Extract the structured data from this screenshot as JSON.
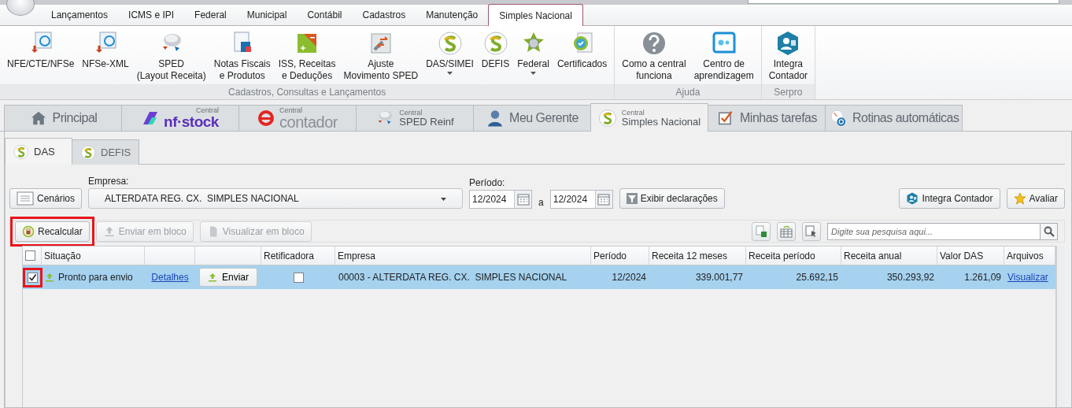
{
  "menu": {
    "tabs": [
      {
        "label": "Lançamentos",
        "selected": false
      },
      {
        "label": "ICMS e IPI",
        "selected": false
      },
      {
        "label": "Federal",
        "selected": false
      },
      {
        "label": "Municipal",
        "selected": false
      },
      {
        "label": "Contábil",
        "selected": false
      },
      {
        "label": "Cadastros",
        "selected": false
      },
      {
        "label": "Manutenção",
        "selected": false
      },
      {
        "label": "Simples Nacional",
        "selected": true
      }
    ]
  },
  "ribbon": {
    "groups": [
      {
        "label": "Cadastros, Consultas e Lançamentos",
        "buttons": [
          {
            "kind": "nfe",
            "label": "NFE/CTE/NFSe",
            "dropdown": false
          },
          {
            "kind": "nfse",
            "label": "NFSe-XML",
            "dropdown": false
          },
          {
            "kind": "sped",
            "label": "SPED\n(Layout Receita)",
            "dropdown": false
          },
          {
            "kind": "notas",
            "label": "Notas Fiscais\ne Produtos",
            "dropdown": false
          },
          {
            "kind": "iss",
            "label": "ISS, Receitas\ne Deduções",
            "dropdown": false
          },
          {
            "kind": "ajuste",
            "label": "Ajuste\nMovimento SPED",
            "dropdown": false
          },
          {
            "kind": "simples",
            "label": "DAS/SIMEI",
            "dropdown": true
          },
          {
            "kind": "simples",
            "label": "DEFIS",
            "dropdown": false
          },
          {
            "kind": "federal",
            "label": "Federal",
            "dropdown": true
          },
          {
            "kind": "cert",
            "label": "Certificados",
            "dropdown": false
          }
        ]
      },
      {
        "label": "Ajuda",
        "buttons": [
          {
            "kind": "help",
            "label": "Como a central\nfunciona",
            "dropdown": false
          },
          {
            "kind": "learn",
            "label": "Centro de\naprendizagem",
            "dropdown": false
          }
        ]
      },
      {
        "label": "Serpro",
        "buttons": [
          {
            "kind": "integra",
            "label": "Integra\nContador",
            "dropdown": false
          }
        ]
      }
    ]
  },
  "main_tabs": [
    {
      "kind": "home",
      "label": "Principal",
      "selected": false
    },
    {
      "kind": "nfstock",
      "small": "Central",
      "label": "nf·stock",
      "selected": false
    },
    {
      "kind": "contador",
      "small": "Central",
      "label": "contador",
      "selected": false
    },
    {
      "kind": "sped",
      "small": "Central",
      "label": "SPED Reinf",
      "selected": false
    },
    {
      "kind": "person",
      "label": "Meu Gerente",
      "selected": false
    },
    {
      "kind": "simples",
      "small": "Central",
      "label": "Simples Nacional",
      "selected": true
    },
    {
      "kind": "check",
      "label": "Minhas tarefas",
      "selected": false
    },
    {
      "kind": "clock",
      "label": "Rotinas automáticas",
      "selected": false
    }
  ],
  "sub_tabs": [
    {
      "label": "DAS",
      "selected": true
    },
    {
      "label": "DEFIS",
      "selected": false
    }
  ],
  "form": {
    "cenarios": "Cenários",
    "empresa_label": "Empresa:",
    "empresa_value": "ALTERDATA REG. CX.  SIMPLES NACIONAL",
    "periodo_label": "Período:",
    "periodo_from": "12/2024",
    "periodo_separator": "a",
    "periodo_to": "12/2024",
    "exibir": "Exibir declarações",
    "integra": "Integra Contador",
    "avaliar": "Avaliar"
  },
  "toolbar": {
    "buttons": [
      {
        "kind": "calc",
        "label": "Recalcular",
        "disabled": false,
        "highlighted": true
      },
      {
        "kind": "upload",
        "label": "Enviar em bloco",
        "disabled": true,
        "highlighted": false
      },
      {
        "kind": "page",
        "label": "Visualizar em bloco",
        "disabled": true,
        "highlighted": false
      }
    ],
    "search_placeholder": "Digite sua pesquisa aqui..."
  },
  "grid": {
    "columns": [
      {
        "kind": "check",
        "checked": false
      },
      {
        "kind": "text",
        "label": "Situação"
      },
      {
        "kind": "blank"
      },
      {
        "kind": "blank"
      },
      {
        "kind": "text",
        "label": "Retificadora"
      },
      {
        "kind": "text",
        "label": "Empresa"
      },
      {
        "kind": "text",
        "label": "Período"
      },
      {
        "kind": "text",
        "label": "Receita 12 meses"
      },
      {
        "kind": "text",
        "label": "Receita período"
      },
      {
        "kind": "text",
        "label": "Receita anual"
      },
      {
        "kind": "text",
        "label": "Valor DAS"
      },
      {
        "kind": "text",
        "label": "Arquivos"
      }
    ],
    "rows": [
      {
        "selected": true,
        "checked": true,
        "check_highlighted": true,
        "situacao": "Pronto para envio",
        "detalhes": "Detalhes",
        "enviar": "Enviar",
        "retificadora": false,
        "empresa": "00003 - ALTERDATA REG. CX.  SIMPLES NACIONAL",
        "periodo": "12/2024",
        "receita_12_meses": "339.001,77",
        "receita_periodo": "25.692,15",
        "receita_anual": "350.293,92",
        "valor_das": "1.261,09",
        "arquivos": "Visualizar"
      }
    ]
  }
}
